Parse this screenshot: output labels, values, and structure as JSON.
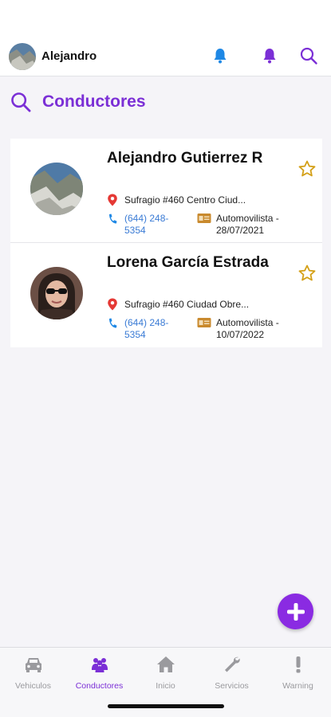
{
  "header": {
    "user_name": "Alejandro"
  },
  "page": {
    "title": "Conductores"
  },
  "drivers": [
    {
      "name": "Alejandro Gutierrez R",
      "address": "Sufragio #460 Centro Ciud...",
      "phone": "(644) 248-5354",
      "license": "Automovilista - 28/07/2021",
      "favorite_icon": "star-outline"
    },
    {
      "name": "Lorena García Estrada",
      "address": "Sufragio #460 Ciudad Obre...",
      "phone": "(644) 248-5354",
      "license": "Automovilista - 10/07/2022",
      "favorite_icon": "star-outline"
    }
  ],
  "tabs": [
    {
      "label": "Vehiculos",
      "icon": "car-icon",
      "active": false
    },
    {
      "label": "Conductores",
      "icon": "people-icon",
      "active": true
    },
    {
      "label": "Inicio",
      "icon": "home-icon",
      "active": false
    },
    {
      "label": "Servicios",
      "icon": "wrench-icon",
      "active": false
    },
    {
      "label": "Warning",
      "icon": "exclamation-icon",
      "active": false
    }
  ],
  "colors": {
    "accent": "#7b2fd6",
    "fab": "#8a2be2",
    "bell_blue": "#1e88e5",
    "phone_blue": "#3a7bd5",
    "pin_red": "#e53935",
    "star_gold": "#d4a017",
    "license_orange": "#c98a2e",
    "tab_inactive": "#9a9a9e"
  }
}
